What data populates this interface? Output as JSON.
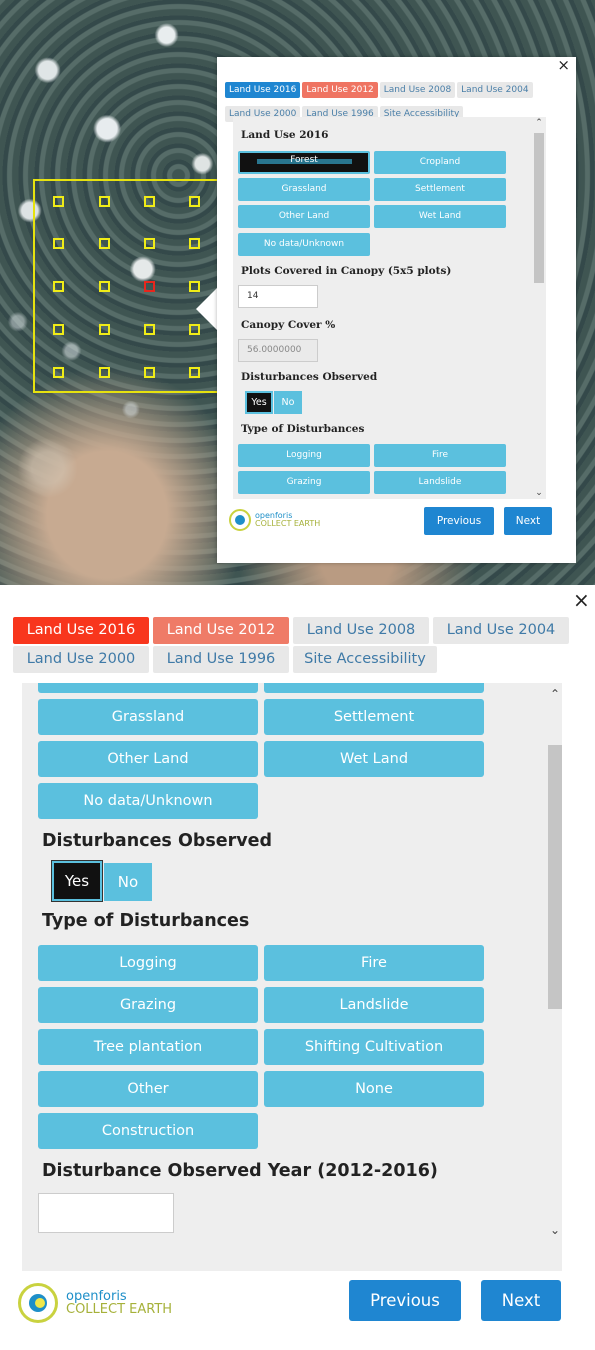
{
  "close_glyph": "×",
  "tabs": [
    {
      "label": "Land Use 2016",
      "state": "active"
    },
    {
      "label": "Land Use 2012",
      "state": "previous"
    },
    {
      "label": "Land Use 2008",
      "state": "inactive"
    },
    {
      "label": "Land Use 2004",
      "state": "inactive"
    },
    {
      "label": "Land Use 2000",
      "state": "inactive"
    },
    {
      "label": "Land Use 1996",
      "state": "inactive"
    },
    {
      "label": "Site Accessibility",
      "state": "inactive"
    }
  ],
  "top_form": {
    "land_use_heading": "Land Use 2016",
    "land_use_options": [
      "Forest",
      "Cropland",
      "Grassland",
      "Settlement",
      "Other Land",
      "Wet Land",
      "No data/Unknown"
    ],
    "land_use_selected": "Forest",
    "canopy_plots_label": "Plots Covered in Canopy (5x5 plots)",
    "canopy_plots_value": "14",
    "canopy_cover_label": "Canopy Cover %",
    "canopy_cover_value": "56.0000000",
    "disturbances_label": "Disturbances Observed",
    "yes_label": "Yes",
    "no_label": "No",
    "type_label": "Type of Disturbances",
    "type_options_visible": [
      "Logging",
      "Fire",
      "Grazing",
      "Landslide"
    ]
  },
  "bottom_form": {
    "land_use_options": [
      "Grassland",
      "Settlement",
      "Other Land",
      "Wet Land",
      "No data/Unknown"
    ],
    "disturbances_label": "Disturbances Observed",
    "yes_label": "Yes",
    "no_label": "No",
    "disturbances_selected": "Yes",
    "type_label": "Type of Disturbances",
    "type_options": [
      "Logging",
      "Fire",
      "Grazing",
      "Landslide",
      "Tree plantation",
      "Shifting Cultivation",
      "Other",
      "None",
      "Construction"
    ],
    "year_label": "Disturbance Observed Year (2012-2016)",
    "year_value": ""
  },
  "footer": {
    "logo_line1": "openforis",
    "logo_line2": "COLLECT EARTH",
    "previous_label": "Previous",
    "next_label": "Next"
  },
  "scroll_up_glyph": "⌃",
  "scroll_down_glyph": "⌄",
  "colors": {
    "active_tab": "#f8361d",
    "previous_tab": "#ef7b67",
    "option_button": "#5bc0de",
    "nav_button": "#1f86d1",
    "plot_grid": "#e6e20f",
    "plot_selected": "#e8261d"
  }
}
